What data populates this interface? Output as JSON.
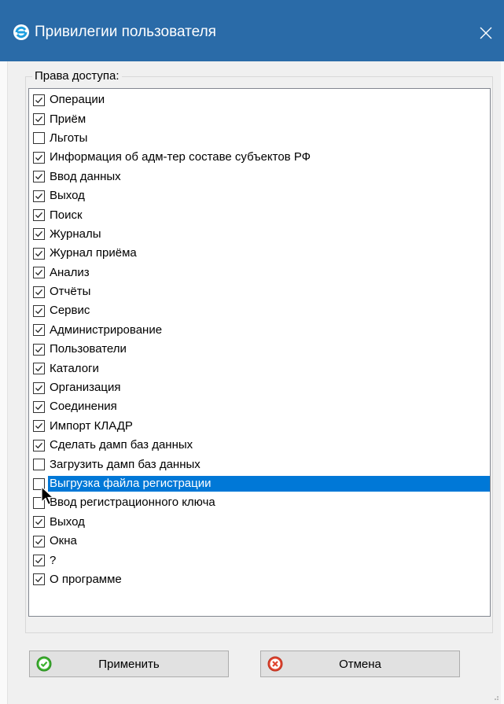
{
  "window": {
    "title": "Привилегии пользователя"
  },
  "group": {
    "legend": "Права доступа:"
  },
  "permissions": [
    {
      "label": "Операции",
      "checked": true
    },
    {
      "label": "Приём",
      "checked": true
    },
    {
      "label": "Льготы",
      "checked": false
    },
    {
      "label": "Информация об адм-тер составе субъектов РФ",
      "checked": true
    },
    {
      "label": "Ввод данных",
      "checked": true
    },
    {
      "label": "Выход",
      "checked": true
    },
    {
      "label": "Поиск",
      "checked": true
    },
    {
      "label": "Журналы",
      "checked": true
    },
    {
      "label": "Журнал приёма",
      "checked": true
    },
    {
      "label": "Анализ",
      "checked": true
    },
    {
      "label": "Отчёты",
      "checked": true
    },
    {
      "label": "Сервис",
      "checked": true
    },
    {
      "label": "Администрирование",
      "checked": true
    },
    {
      "label": "Пользователи",
      "checked": true
    },
    {
      "label": "Каталоги",
      "checked": true
    },
    {
      "label": "Организация",
      "checked": true
    },
    {
      "label": "Соединения",
      "checked": true
    },
    {
      "label": "Импорт КЛАДР",
      "checked": true
    },
    {
      "label": "Сделать дамп баз данных",
      "checked": true
    },
    {
      "label": "Загрузить дамп баз данных",
      "checked": false
    },
    {
      "label": "Выгрузка файла регистрации",
      "checked": false,
      "selected": true
    },
    {
      "label": "Ввод регистрационного ключа",
      "checked": false
    },
    {
      "label": "Выход",
      "checked": true
    },
    {
      "label": "Окна",
      "checked": true
    },
    {
      "label": "?",
      "checked": true
    },
    {
      "label": "О программе",
      "checked": true
    }
  ],
  "buttons": {
    "apply_label": "Применить",
    "cancel_label": "Отмена"
  },
  "colors": {
    "titlebar": "#2a6ba8",
    "selection": "#0078d7",
    "apply_icon": "#3cb22f",
    "cancel_icon": "#e0442f"
  }
}
